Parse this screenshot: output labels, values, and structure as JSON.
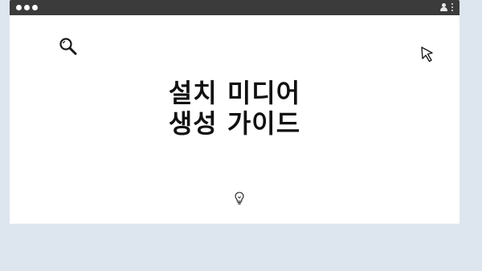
{
  "top_indicators": [
    "dot",
    "dot",
    "dot",
    "dot"
  ],
  "titlebar": {
    "left_controls": [
      "dot",
      "dot",
      "dot"
    ],
    "right_icons": [
      "user-icon",
      "more-vertical-icon"
    ]
  },
  "content": {
    "icons": {
      "top_left": "search-icon",
      "top_right": "cursor-icon",
      "bottom_center": "lightbulb-icon"
    },
    "headline": {
      "line1": "설치 미디어",
      "line2": "생성 가이드"
    }
  },
  "colors": {
    "background": "#dde6ef",
    "titlebar": "#3b3b3b",
    "window": "#ffffff",
    "text": "#111111"
  }
}
